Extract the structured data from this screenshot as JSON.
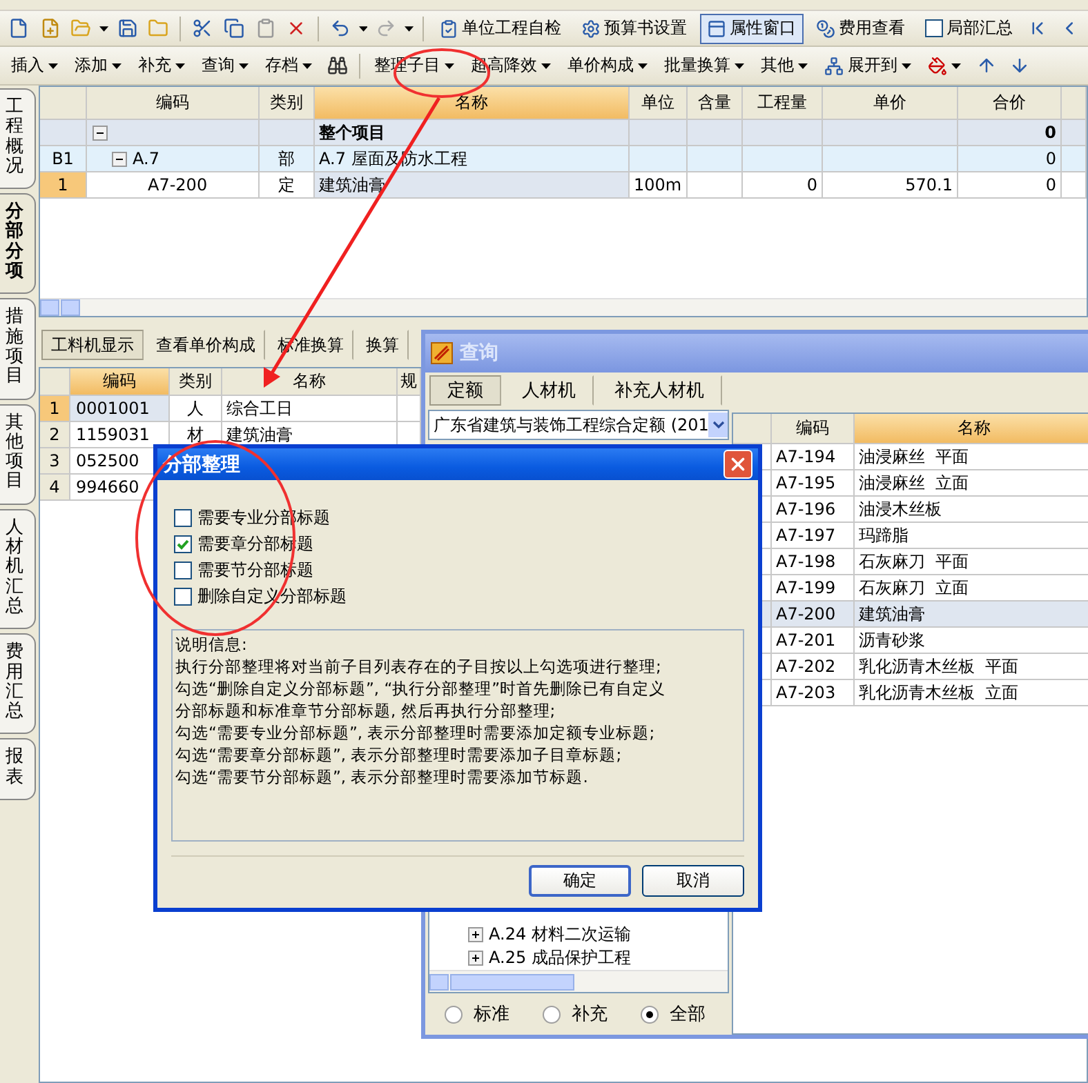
{
  "toolbar": {
    "buttons": [
      {
        "kind": "check",
        "label": "单位工程自检",
        "pressed": false
      },
      {
        "kind": "gear",
        "label": "预算书设置",
        "pressed": false
      },
      {
        "kind": "window",
        "label": "属性窗口",
        "pressed": true
      },
      {
        "kind": "coins",
        "label": "费用查看",
        "pressed": false
      }
    ],
    "local_summary": {
      "label": "局部汇总",
      "checked": false
    }
  },
  "command_bar": [
    {
      "kind": "menu",
      "label": "插入"
    },
    {
      "kind": "menu",
      "label": "添加"
    },
    {
      "kind": "menu",
      "label": "补充"
    },
    {
      "kind": "menu",
      "label": "查询"
    },
    {
      "kind": "menu",
      "label": "存档"
    },
    {
      "kind": "find"
    },
    {
      "kind": "menu",
      "label": "整理子目"
    },
    {
      "kind": "menu",
      "label": "超高降效"
    },
    {
      "kind": "menu",
      "label": "单价构成"
    },
    {
      "kind": "menu",
      "label": "批量换算"
    },
    {
      "kind": "menu",
      "label": "其他"
    },
    {
      "kind": "expand",
      "label": "展开到"
    },
    {
      "kind": "paint"
    },
    {
      "kind": "up"
    },
    {
      "kind": "down"
    }
  ],
  "side_tabs": [
    {
      "label": "工程概况",
      "selected": false
    },
    {
      "label": "分部分项",
      "selected": true
    },
    {
      "label": "措施项目",
      "selected": false
    },
    {
      "label": "其他项目",
      "selected": false
    },
    {
      "label": "人材机汇总",
      "selected": false
    },
    {
      "label": "费用汇总",
      "selected": false
    },
    {
      "label": "报表",
      "selected": false
    }
  ],
  "main_grid": {
    "columns": [
      {
        "label": "编码",
        "selected": false
      },
      {
        "label": "类别",
        "selected": false
      },
      {
        "label": "名称",
        "selected": true
      },
      {
        "label": "单位",
        "selected": false
      },
      {
        "label": "含量",
        "selected": false
      },
      {
        "label": "工程量",
        "selected": false
      },
      {
        "label": "单价",
        "selected": false
      },
      {
        "label": "合价",
        "selected": false
      }
    ],
    "rows": [
      {
        "kind": "root",
        "expanded": true,
        "selected": false,
        "name": "整个项目",
        "total": "0"
      },
      {
        "kind": "section",
        "expanded": true,
        "selected": false,
        "number": "B1",
        "code": "A.7",
        "type": "部",
        "name": "A.7 屋面及防水工程",
        "total": "0"
      },
      {
        "kind": "item",
        "selected": true,
        "number": "1",
        "code": "A7-200",
        "type": "定",
        "name": "建筑油膏",
        "unit": "100m",
        "quantity": "0",
        "price": "570.1",
        "total": "0"
      }
    ]
  },
  "detail": {
    "tabs": [
      {
        "label": "工料机显示",
        "selected": true
      },
      {
        "label": "查看单价构成",
        "selected": false
      },
      {
        "label": "标准换算",
        "selected": false
      },
      {
        "label": "换算",
        "selected": false
      }
    ],
    "columns": [
      {
        "label": "编码",
        "selected": true
      },
      {
        "label": "类别",
        "selected": false
      },
      {
        "label": "名称",
        "selected": false
      },
      {
        "label": "规",
        "selected": false
      }
    ],
    "rows": [
      {
        "number": "1",
        "code": "0001001",
        "type": "人",
        "name": "综合工日",
        "selected": true
      },
      {
        "number": "2",
        "code": "1159031",
        "type": "材",
        "name": "建筑油膏",
        "selected": false
      },
      {
        "number": "3",
        "code": "052500",
        "selected": false
      },
      {
        "number": "4",
        "code": "994660",
        "selected": false
      }
    ]
  },
  "query_window": {
    "title": "查询",
    "tabs": [
      {
        "label": "定额",
        "selected": true
      },
      {
        "label": "人材机",
        "selected": false
      },
      {
        "label": "补充人材机",
        "selected": false
      }
    ],
    "library": "广东省建筑与装饰工程综合定额 (201",
    "tree": [
      {
        "label": "A.24 材料二次运输",
        "expanded": false
      },
      {
        "label": "A.25 成品保护工程",
        "expanded": false
      }
    ],
    "radios": [
      {
        "label": "标准",
        "selected": false
      },
      {
        "label": "补充",
        "selected": false
      },
      {
        "label": "全部",
        "selected": true
      }
    ],
    "columns": [
      {
        "label": "编码",
        "selected": false
      },
      {
        "label": "名称",
        "selected": true
      }
    ],
    "rows": [
      {
        "code": "A7-194",
        "name": "油浸麻丝  平面",
        "selected": false
      },
      {
        "code": "A7-195",
        "name": "油浸麻丝  立面",
        "selected": false
      },
      {
        "code": "A7-196",
        "name": "油浸木丝板",
        "selected": false
      },
      {
        "code": "A7-197",
        "name": "玛蹄脂",
        "selected": false
      },
      {
        "code": "A7-198",
        "name": "石灰麻刀  平面",
        "selected": false
      },
      {
        "code": "A7-199",
        "name": "石灰麻刀  立面",
        "selected": false
      },
      {
        "code": "A7-200",
        "name": "建筑油膏",
        "selected": true
      },
      {
        "code": "A7-201",
        "name": "沥青砂浆",
        "selected": false
      },
      {
        "code": "A7-202",
        "name": "乳化沥青木丝板  平面",
        "selected": false
      },
      {
        "code": "A7-203",
        "name": "乳化沥青木丝板  立面",
        "selected": false
      }
    ]
  },
  "dialog": {
    "title": "分部整理",
    "options": [
      {
        "label": "需要专业分部标题",
        "checked": false
      },
      {
        "label": "需要章分部标题",
        "checked": true
      },
      {
        "label": "需要节分部标题",
        "checked": false
      },
      {
        "label": "删除自定义分部标题",
        "checked": false
      }
    ],
    "info": [
      "说明信息:",
      "执行分部整理将对当前子目列表存在的子目按以上勾选项进行整理;",
      "勾选“删除自定义分部标题”, “执行分部整理”时首先删除已有自定义",
      "分部标题和标准章节分部标题, 然后再执行分部整理;",
      "勾选“需要专业分部标题”, 表示分部整理时需要添加定额专业标题;",
      "勾选“需要章分部标题”, 表示分部整理时需要添加子目章标题;",
      "勾选“需要节分部标题”, 表示分部整理时需要添加节标题."
    ],
    "buttons": [
      {
        "label": "确定",
        "default": true
      },
      {
        "label": "取消",
        "default": false
      }
    ]
  }
}
